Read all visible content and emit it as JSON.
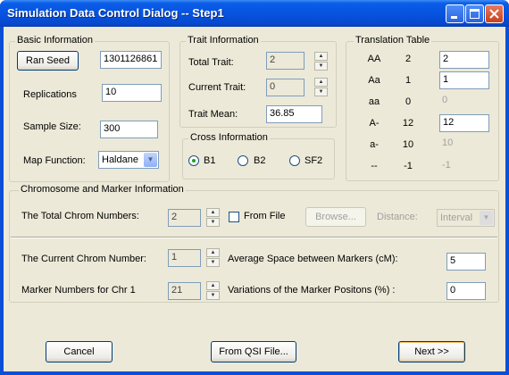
{
  "window": {
    "title": "Simulation Data Control Dialog -- Step1"
  },
  "basic": {
    "group_label": "Basic Information",
    "ran_seed_button": "Ran Seed",
    "ran_seed_value": "1301126861",
    "replications_label": "Replications",
    "replications_value": "10",
    "sample_size_label": "Sample Size:",
    "sample_size_value": "300",
    "map_function_label": "Map Function:",
    "map_function_value": "Haldane"
  },
  "trait": {
    "group_label": "Trait Information",
    "total_trait_label": "Total Trait:",
    "total_trait_value": "2",
    "current_trait_label": "Current Trait:",
    "current_trait_value": "0",
    "trait_mean_label": "Trait Mean:",
    "trait_mean_value": "36.85"
  },
  "cross": {
    "group_label": "Cross Information",
    "b1": "B1",
    "b2": "B2",
    "sf2": "SF2",
    "selected": "B1"
  },
  "translation": {
    "group_label": "Translation Table",
    "rows": [
      {
        "code": "AA",
        "num": "2",
        "value": "2"
      },
      {
        "code": "Aa",
        "num": "1",
        "value": "1"
      },
      {
        "code": "aa",
        "num": "0",
        "value": "0"
      },
      {
        "code": "A-",
        "num": "12",
        "value": "12"
      },
      {
        "code": "a-",
        "num": "10",
        "value": "10"
      },
      {
        "code": "--",
        "num": "-1",
        "value": "-1"
      }
    ]
  },
  "chrom": {
    "group_label": "Chromosome and Marker Information",
    "total_label": "The Total Chrom Numbers:",
    "total_value": "2",
    "from_file": "From File",
    "browse": "Browse...",
    "distance_label": "Distance:",
    "distance_value": "Interval",
    "current_label": "The Current Chrom Number:",
    "current_value": "1",
    "avg_space_label": "Average Space between Markers (cM):",
    "avg_space_value": "5",
    "marker_label": "Marker Numbers for Chr 1",
    "marker_value": "21",
    "variation_label": "Variations of the Marker Positons (%) :",
    "variation_value": "0"
  },
  "buttons": {
    "cancel": "Cancel",
    "from_qsi": "From QSI File...",
    "next": "Next >>"
  }
}
